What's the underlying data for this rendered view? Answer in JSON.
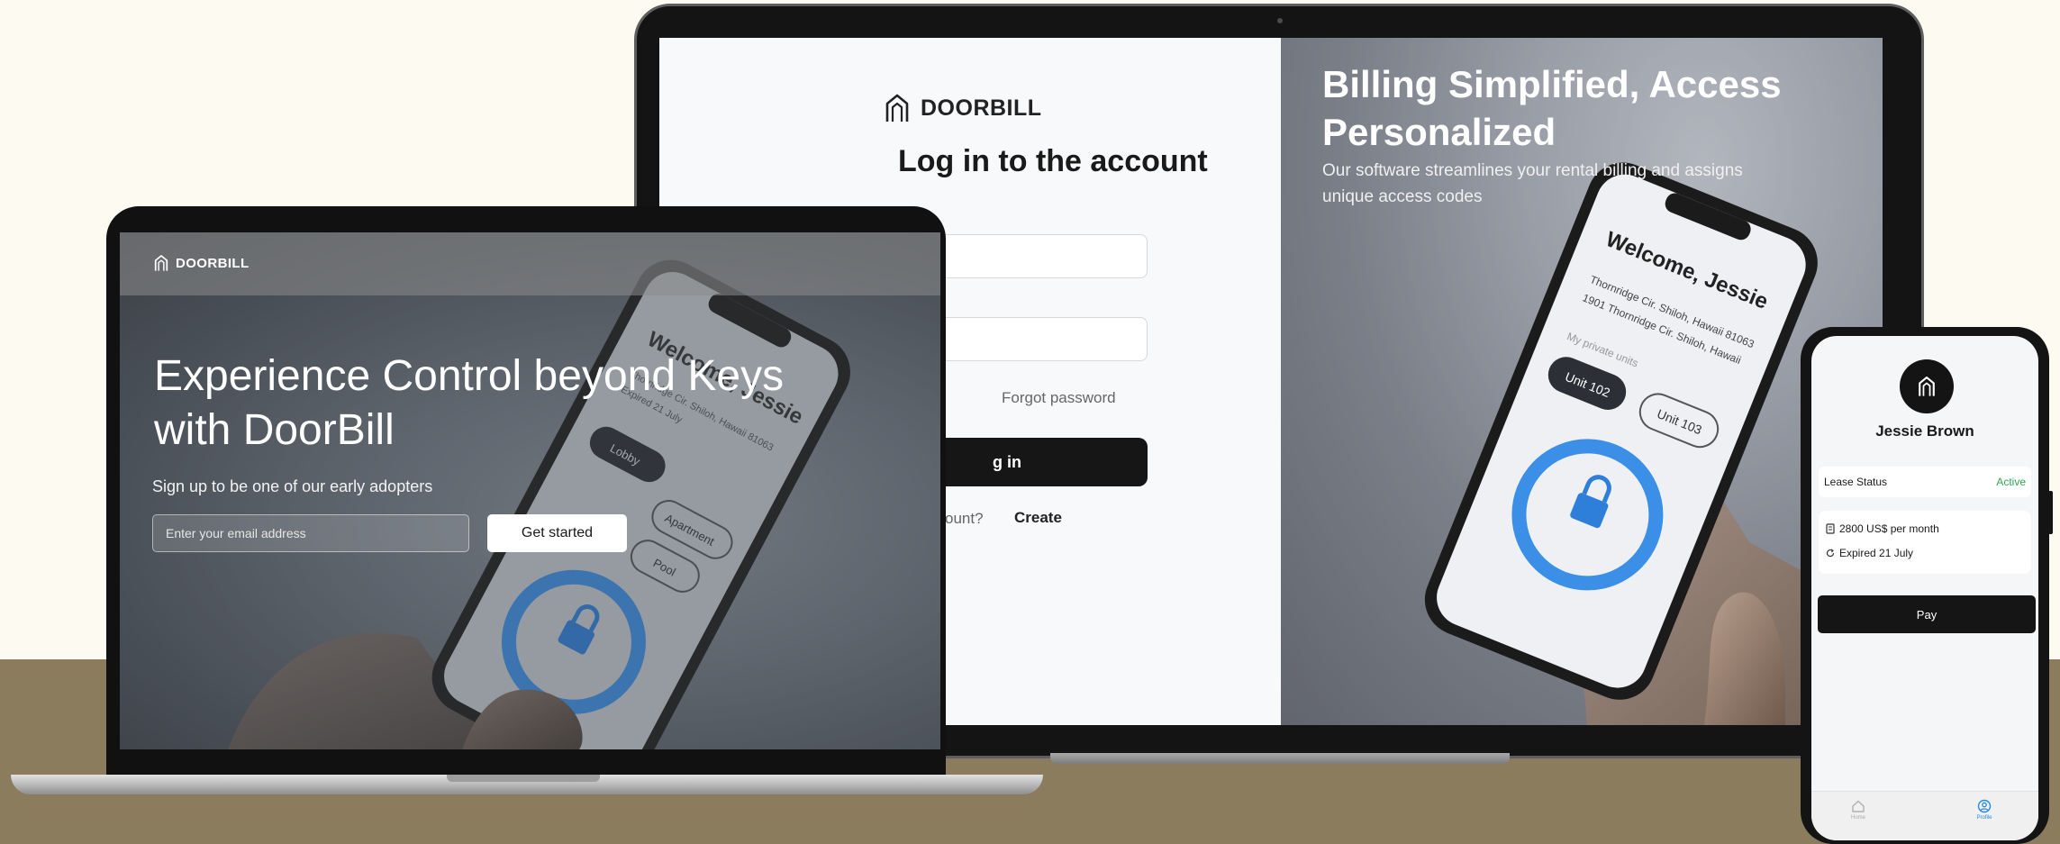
{
  "brand": "DOORBILL",
  "back_laptop": {
    "login_title": "Log in to the account",
    "forgot": "Forgot password",
    "login_button": "g in",
    "no_account": "ccount?",
    "create": "Create",
    "hero_title": "Billing Simplified, Access Personalized",
    "hero_subtitle": "Our software streamlines your rental billing and assigns unique access codes"
  },
  "front_laptop": {
    "title": "Experience Control beyond Keys with DoorBill",
    "subtitle": "Sign up to be one of our early adopters",
    "email_placeholder": "Enter your email address",
    "cta": "Get started"
  },
  "phone": {
    "name": "Jessie Brown",
    "lease_status_label": "Lease Status",
    "lease_status_value": "Active",
    "price": "2800 US$ per month",
    "expiry": "Expired 21 July",
    "pay": "Pay",
    "tab_home": "Home",
    "tab_profile": "Profile"
  },
  "colors": {
    "accent_active": "#2fa84f",
    "dark": "#141414",
    "tab_active": "#2a8ad8"
  },
  "icons": [
    "doorbill-logo-icon",
    "receipt-icon",
    "refresh-icon",
    "home-icon",
    "profile-icon"
  ]
}
